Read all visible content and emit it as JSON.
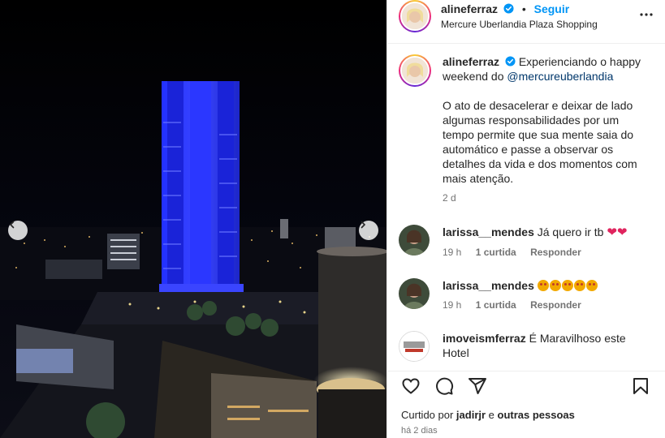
{
  "post": {
    "author": "alineferraz",
    "follow_label": "Seguir",
    "separator": "•",
    "location": "Mercure Uberlandia Plaza Shopping"
  },
  "caption": {
    "author": "alineferraz",
    "line1": "Experienciando o happy weekend do ",
    "mention": "@mercureuberlandia",
    "paragraph2": "O ato de desacelerar e deixar de lado algumas responsabilidades por um tempo permite que sua mente saia do automático e passe a observar os detalhes da vida e dos momentos com mais atenção.",
    "age": "2 d"
  },
  "comments": [
    {
      "user": "larissa__mendes",
      "text": "Já quero ir tb",
      "emoji": [
        "red-heart",
        "red-heart"
      ],
      "age": "19 h",
      "likes": "1 curtida",
      "reply": "Responder"
    },
    {
      "user": "larissa__mendes",
      "text": "",
      "emoji": [
        "star-eyes",
        "star-eyes",
        "star-eyes",
        "star-eyes",
        "star-eyes"
      ],
      "age": "19 h",
      "likes": "1 curtida",
      "reply": "Responder"
    },
    {
      "user": "imoveismferraz",
      "text": "É Maravilhoso este Hotel",
      "avatar_logo": "MFERRAZ"
    }
  ],
  "actions": {
    "liked_by_prefix": "Curtido por ",
    "liked_by_user": "jadirjr",
    "liked_by_joiner": " e ",
    "liked_by_others": "outras pessoas",
    "date": "há 2 dias"
  },
  "icons": [
    "verified-badge-icon",
    "more-options-icon",
    "carousel-prev-icon",
    "carousel-next-icon",
    "like-heart-icon",
    "comment-icon",
    "share-icon",
    "save-bookmark-icon",
    "comment-like-icon"
  ],
  "colors": {
    "accent": "#0095f6",
    "verified": "#0095f6",
    "building_light": "#1f2bff",
    "secondary_text": "#737373"
  }
}
